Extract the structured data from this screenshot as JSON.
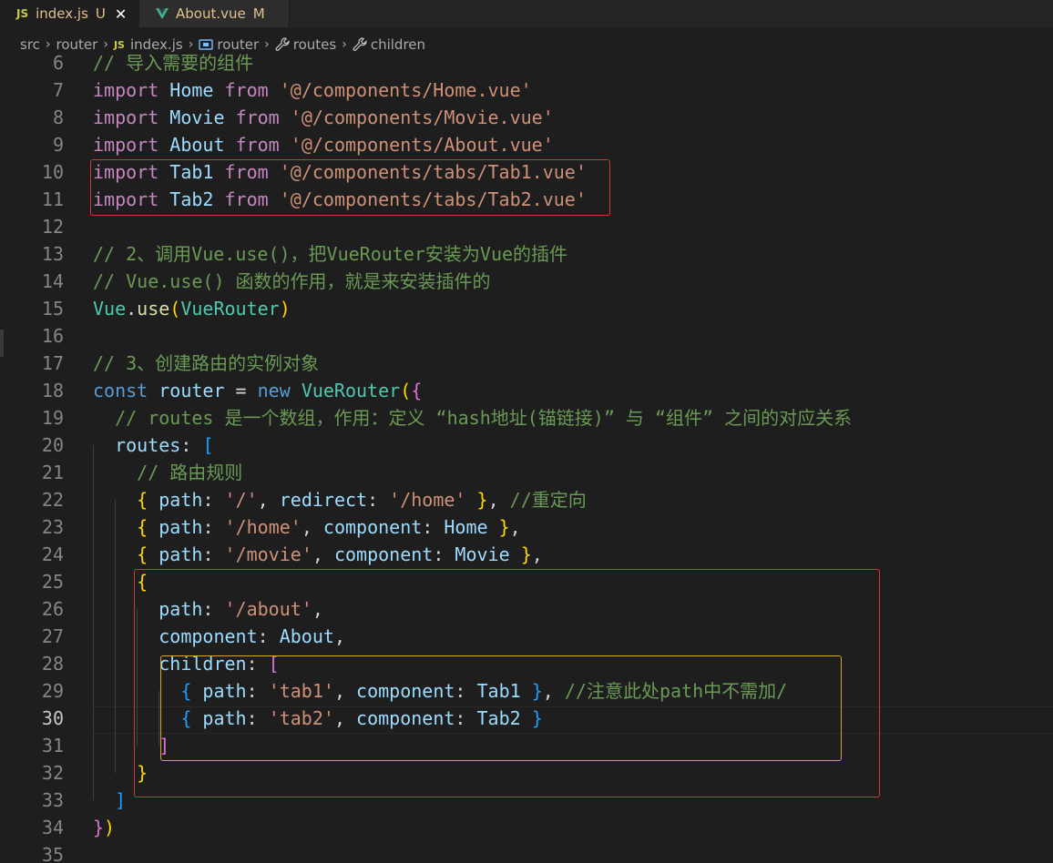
{
  "tabs": [
    {
      "badge": "JS",
      "name": "index.js",
      "status": "U",
      "close": "✕",
      "active": true
    },
    {
      "badge": "vue",
      "name": "About.vue",
      "status": "M",
      "active": false
    }
  ],
  "breadcrumb": {
    "items": [
      "src",
      "router",
      "index.js",
      "router",
      "routes",
      "children"
    ],
    "js_badge": "JS"
  },
  "current_line": 30,
  "lines": [
    {
      "n": 6,
      "t": [
        [
          "cm",
          "// 导入需要的组件"
        ]
      ]
    },
    {
      "n": 7,
      "t": [
        [
          "k",
          "import"
        ],
        [
          "pn",
          " "
        ],
        [
          "id",
          "Home"
        ],
        [
          "pn",
          " "
        ],
        [
          "k",
          "from"
        ],
        [
          "pn",
          " "
        ],
        [
          "str",
          "'@/components/Home.vue'"
        ]
      ]
    },
    {
      "n": 8,
      "t": [
        [
          "k",
          "import"
        ],
        [
          "pn",
          " "
        ],
        [
          "id",
          "Movie"
        ],
        [
          "pn",
          " "
        ],
        [
          "k",
          "from"
        ],
        [
          "pn",
          " "
        ],
        [
          "str",
          "'@/components/Movie.vue'"
        ]
      ]
    },
    {
      "n": 9,
      "t": [
        [
          "k",
          "import"
        ],
        [
          "pn",
          " "
        ],
        [
          "id",
          "About"
        ],
        [
          "pn",
          " "
        ],
        [
          "k",
          "from"
        ],
        [
          "pn",
          " "
        ],
        [
          "str",
          "'@/components/About.vue'"
        ]
      ]
    },
    {
      "n": 10,
      "t": [
        [
          "k",
          "import"
        ],
        [
          "pn",
          " "
        ],
        [
          "id",
          "Tab1"
        ],
        [
          "pn",
          " "
        ],
        [
          "k",
          "from"
        ],
        [
          "pn",
          " "
        ],
        [
          "str",
          "'@/components/tabs/Tab1.vue'"
        ]
      ]
    },
    {
      "n": 11,
      "t": [
        [
          "k",
          "import"
        ],
        [
          "pn",
          " "
        ],
        [
          "id",
          "Tab2"
        ],
        [
          "pn",
          " "
        ],
        [
          "k",
          "from"
        ],
        [
          "pn",
          " "
        ],
        [
          "str",
          "'@/components/tabs/Tab2.vue'"
        ]
      ]
    },
    {
      "n": 12,
      "t": []
    },
    {
      "n": 13,
      "t": [
        [
          "cm",
          "// 2、调用Vue.use()，把VueRouter安装为Vue的插件"
        ]
      ]
    },
    {
      "n": 14,
      "t": [
        [
          "cm",
          "// Vue.use() 函数的作用，就是来安装插件的"
        ]
      ]
    },
    {
      "n": 15,
      "t": [
        [
          "cls",
          "Vue"
        ],
        [
          "pn",
          "."
        ],
        [
          "fn",
          "use"
        ],
        [
          "br1",
          "("
        ],
        [
          "cls",
          "VueRouter"
        ],
        [
          "br1",
          ")"
        ]
      ]
    },
    {
      "n": 16,
      "t": []
    },
    {
      "n": 17,
      "t": [
        [
          "cm",
          "// 3、创建路由的实例对象"
        ]
      ]
    },
    {
      "n": 18,
      "t": [
        [
          "kb",
          "const"
        ],
        [
          "pn",
          " "
        ],
        [
          "id",
          "router"
        ],
        [
          "pn",
          " = "
        ],
        [
          "kb",
          "new"
        ],
        [
          "pn",
          " "
        ],
        [
          "cls",
          "VueRouter"
        ],
        [
          "br1",
          "("
        ],
        [
          "br2",
          "{"
        ]
      ]
    },
    {
      "n": 19,
      "t": [
        [
          "pn",
          "  "
        ],
        [
          "cm",
          "// routes 是一个数组，作用：定义 “hash地址(锚链接)” 与 “组件” 之间的对应关系"
        ]
      ]
    },
    {
      "n": 20,
      "t": [
        [
          "pn",
          "  "
        ],
        [
          "id",
          "routes"
        ],
        [
          "pn",
          ": "
        ],
        [
          "br3",
          "["
        ]
      ]
    },
    {
      "n": 21,
      "t": [
        [
          "pn",
          "    "
        ],
        [
          "cm",
          "// 路由规则"
        ]
      ]
    },
    {
      "n": 22,
      "t": [
        [
          "pn",
          "    "
        ],
        [
          "br1",
          "{"
        ],
        [
          "pn",
          " "
        ],
        [
          "id",
          "path"
        ],
        [
          "pn",
          ": "
        ],
        [
          "str",
          "'/'"
        ],
        [
          "pn",
          ", "
        ],
        [
          "id",
          "redirect"
        ],
        [
          "pn",
          ": "
        ],
        [
          "str",
          "'/home'"
        ],
        [
          "pn",
          " "
        ],
        [
          "br1",
          "}"
        ],
        [
          "pn",
          ", "
        ],
        [
          "cm",
          "//重定向"
        ]
      ]
    },
    {
      "n": 23,
      "t": [
        [
          "pn",
          "    "
        ],
        [
          "br1",
          "{"
        ],
        [
          "pn",
          " "
        ],
        [
          "id",
          "path"
        ],
        [
          "pn",
          ": "
        ],
        [
          "str",
          "'/home'"
        ],
        [
          "pn",
          ", "
        ],
        [
          "id",
          "component"
        ],
        [
          "pn",
          ": "
        ],
        [
          "id",
          "Home"
        ],
        [
          "pn",
          " "
        ],
        [
          "br1",
          "}"
        ],
        [
          "pn",
          ","
        ]
      ]
    },
    {
      "n": 24,
      "t": [
        [
          "pn",
          "    "
        ],
        [
          "br1",
          "{"
        ],
        [
          "pn",
          " "
        ],
        [
          "id",
          "path"
        ],
        [
          "pn",
          ": "
        ],
        [
          "str",
          "'/movie'"
        ],
        [
          "pn",
          ", "
        ],
        [
          "id",
          "component"
        ],
        [
          "pn",
          ": "
        ],
        [
          "id",
          "Movie"
        ],
        [
          "pn",
          " "
        ],
        [
          "br1",
          "}"
        ],
        [
          "pn",
          ","
        ]
      ]
    },
    {
      "n": 25,
      "t": [
        [
          "pn",
          "    "
        ],
        [
          "br1",
          "{"
        ]
      ]
    },
    {
      "n": 26,
      "t": [
        [
          "pn",
          "      "
        ],
        [
          "id",
          "path"
        ],
        [
          "pn",
          ": "
        ],
        [
          "str",
          "'/about'"
        ],
        [
          "pn",
          ","
        ]
      ]
    },
    {
      "n": 27,
      "t": [
        [
          "pn",
          "      "
        ],
        [
          "id",
          "component"
        ],
        [
          "pn",
          ": "
        ],
        [
          "id",
          "About"
        ],
        [
          "pn",
          ","
        ]
      ]
    },
    {
      "n": 28,
      "t": [
        [
          "pn",
          "      "
        ],
        [
          "id",
          "children"
        ],
        [
          "pn",
          ": "
        ],
        [
          "br2",
          "["
        ]
      ]
    },
    {
      "n": 29,
      "t": [
        [
          "pn",
          "        "
        ],
        [
          "br3",
          "{"
        ],
        [
          "pn",
          " "
        ],
        [
          "id",
          "path"
        ],
        [
          "pn",
          ": "
        ],
        [
          "str",
          "'tab1'"
        ],
        [
          "pn",
          ", "
        ],
        [
          "id",
          "component"
        ],
        [
          "pn",
          ": "
        ],
        [
          "id",
          "Tab1"
        ],
        [
          "pn",
          " "
        ],
        [
          "br3",
          "}"
        ],
        [
          "pn",
          ", "
        ],
        [
          "cm",
          "//注意此处path中不需加/"
        ]
      ]
    },
    {
      "n": 30,
      "t": [
        [
          "pn",
          "        "
        ],
        [
          "br3",
          "{"
        ],
        [
          "pn",
          " "
        ],
        [
          "id",
          "path"
        ],
        [
          "pn",
          ": "
        ],
        [
          "str",
          "'tab2'"
        ],
        [
          "pn",
          ", "
        ],
        [
          "id",
          "component"
        ],
        [
          "pn",
          ": "
        ],
        [
          "id",
          "Tab2"
        ],
        [
          "pn",
          " "
        ],
        [
          "br3",
          "}"
        ]
      ]
    },
    {
      "n": 31,
      "t": [
        [
          "pn",
          "      "
        ],
        [
          "br2",
          "]"
        ]
      ]
    },
    {
      "n": 32,
      "t": [
        [
          "pn",
          "    "
        ],
        [
          "br1",
          "}"
        ]
      ]
    },
    {
      "n": 33,
      "t": [
        [
          "pn",
          "  "
        ],
        [
          "br3",
          "]"
        ]
      ]
    },
    {
      "n": 34,
      "t": [
        [
          "br2",
          "}"
        ],
        [
          "br1",
          ")"
        ]
      ]
    },
    {
      "n": 35,
      "t": []
    }
  ],
  "colors": {
    "background": "#1e1e1e",
    "highlight_box_imports": "#d03838",
    "highlight_box_about_route": "#d03838",
    "highlight_box_children": "#d4a72c"
  }
}
